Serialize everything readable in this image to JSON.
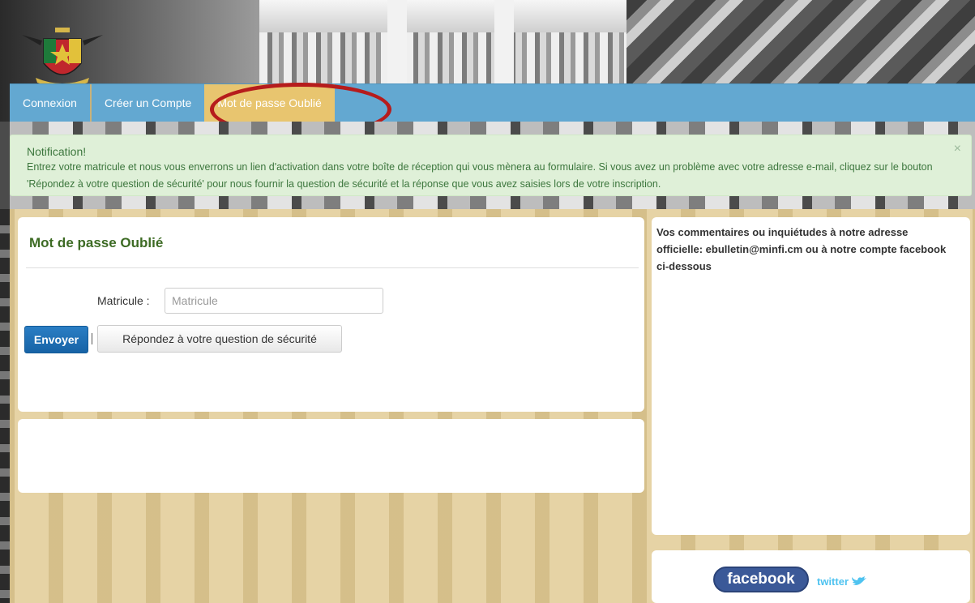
{
  "nav": {
    "items": [
      {
        "label": "Connexion"
      },
      {
        "label": "Créer un Compte"
      },
      {
        "label": "Mot de passe Oublié"
      }
    ]
  },
  "notification": {
    "title": "Notification!",
    "body": "Entrez votre matricule et nous vous enverrons un lien d'activation dans votre boîte de réception qui vous mènera au formulaire. Si vous avez un problème avec votre adresse e-mail, cliquez sur le bouton 'Répondez à votre question de sécurité' pour nous fournir la question de sécurité et la réponse que vous avez saisies lors de votre inscription.",
    "close": "×"
  },
  "form": {
    "title": "Mot de passe Oublié",
    "matricule_label": "Matricule :",
    "matricule_value": "",
    "matricule_placeholder": "Matricule",
    "send_label": "Envoyer",
    "separator": "|",
    "question_label": "Répondez à votre question de sécurité"
  },
  "sidebar": {
    "text": "Vos commentaires ou inquiétudes à notre adresse officielle: ebulletin@minfi.cm ou à notre compte facebook ci-dessous"
  },
  "social": {
    "facebook": "facebook",
    "twitter": "twitter"
  },
  "colors": {
    "nav_bg": "#63a8d1",
    "nav_active": "#e8c56f",
    "notif_bg": "#dff0d8",
    "notif_text": "#3c763d",
    "title_green": "#3d6b24",
    "primary_btn": "#1c6fb5",
    "highlight_ring": "#b61c1c",
    "facebook": "#3b5998",
    "twitter": "#4fc3f0"
  }
}
